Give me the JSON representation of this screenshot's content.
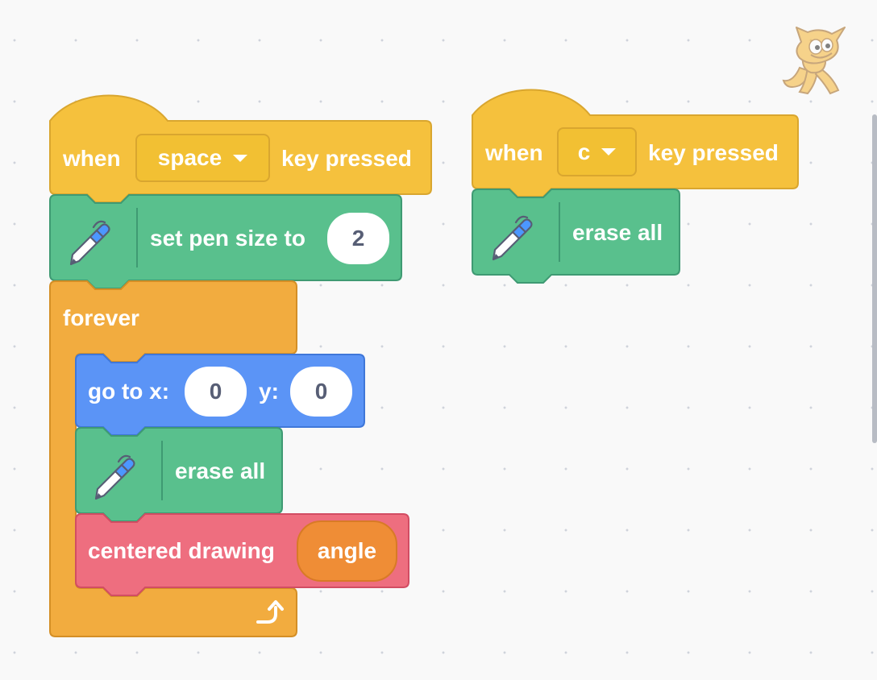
{
  "scripts": [
    {
      "hat": {
        "when": "when",
        "key": "space",
        "suffix": "key pressed"
      },
      "set_pen_size": {
        "label": "set pen size to",
        "value": "2"
      },
      "forever": {
        "label": "forever"
      },
      "goto": {
        "label_x": "go to x:",
        "x": "0",
        "label_y": "y:",
        "y": "0"
      },
      "erase": {
        "label": "erase all"
      },
      "custom": {
        "label": "centered drawing",
        "arg": "angle"
      }
    },
    {
      "hat": {
        "when": "when",
        "key": "c",
        "suffix": "key pressed"
      },
      "erase": {
        "label": "erase all"
      }
    }
  ],
  "icons": {
    "pen": "pen-icon",
    "loop_arrow": "loop-arrow-icon",
    "sprite": "scratch-cat-icon"
  },
  "colors": {
    "events": "#f5c13d",
    "pen": "#59c08d",
    "control": "#f2ac3f",
    "motion": "#5b94f6",
    "custom": "#ee6e7f",
    "reporter": "#ef8d36",
    "background": "#f9f9f9"
  }
}
